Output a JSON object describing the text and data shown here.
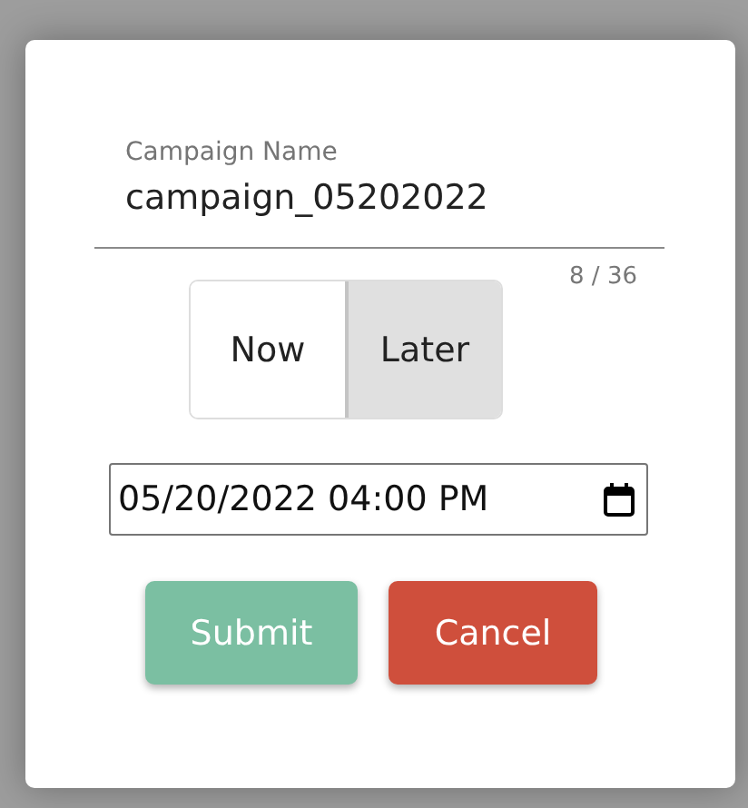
{
  "dialog": {
    "name_field": {
      "label": "Campaign Name",
      "value": "campaign_05202022",
      "counter": "8 / 36"
    },
    "schedule_toggle": [
      {
        "label": "Now",
        "selected": false
      },
      {
        "label": "Later",
        "selected": true
      }
    ],
    "datetime_field": {
      "value": "05/20/2022 04:00 PM"
    },
    "buttons": [
      {
        "label": "Submit",
        "kind": "primary"
      },
      {
        "label": "Cancel",
        "kind": "danger"
      }
    ]
  }
}
